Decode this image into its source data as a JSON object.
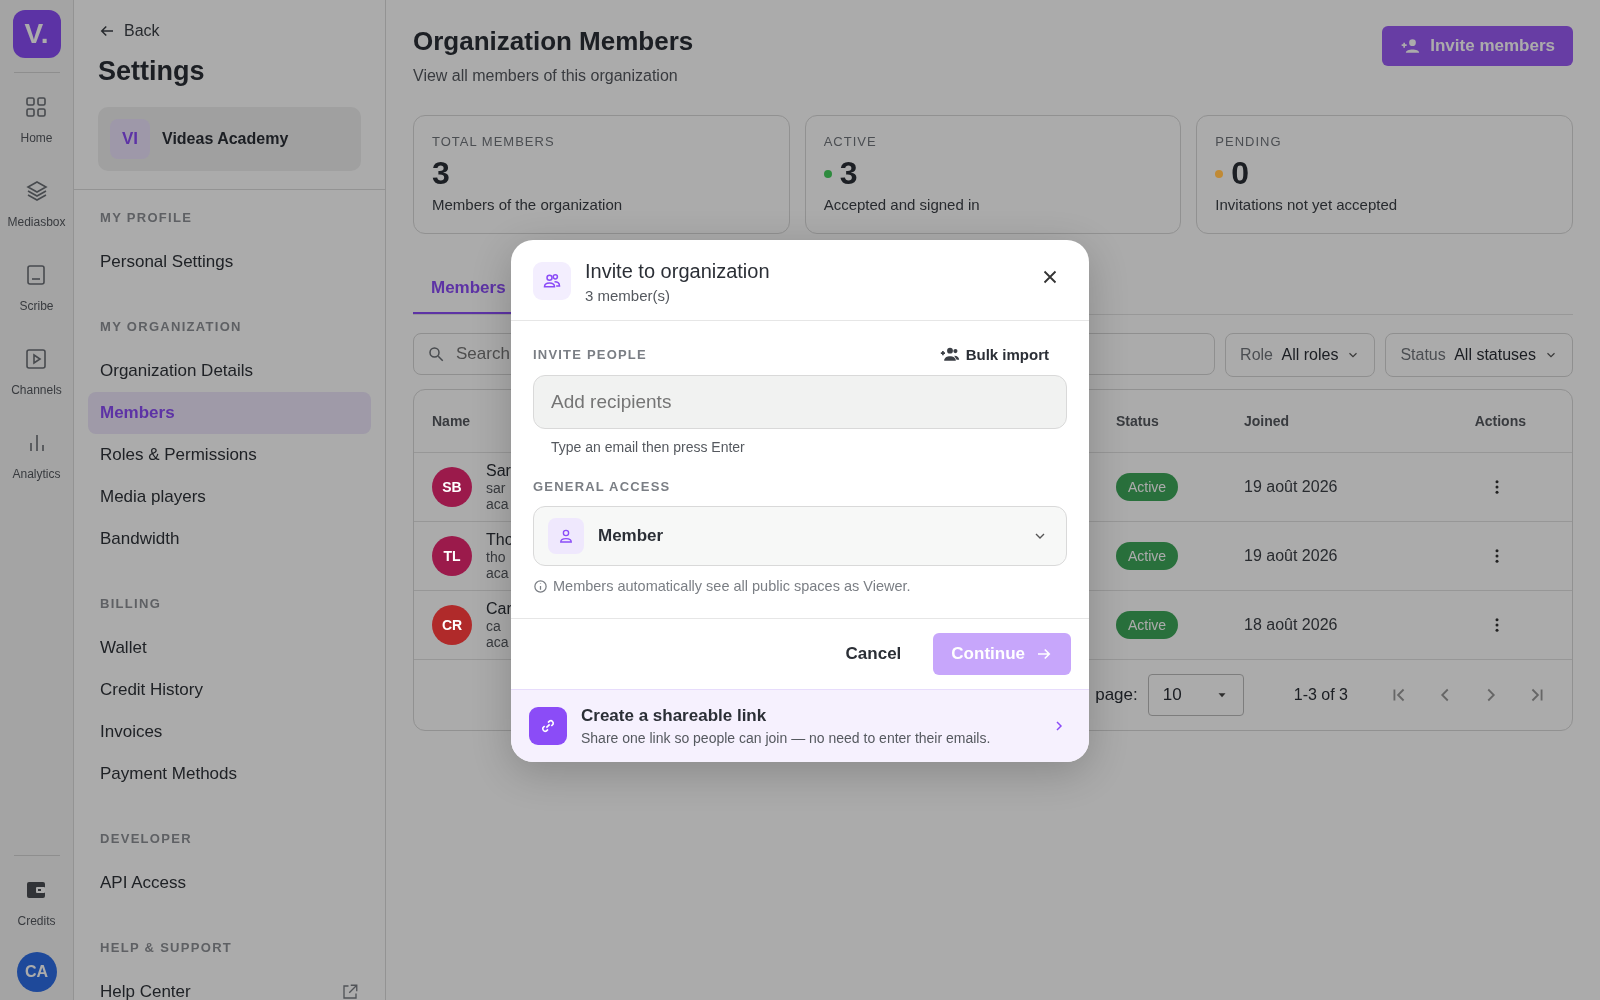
{
  "rail": {
    "logo": "V.",
    "items": [
      {
        "label": "Home"
      },
      {
        "label": "Mediasbox"
      },
      {
        "label": "Scribe"
      },
      {
        "label": "Channels"
      },
      {
        "label": "Analytics"
      }
    ],
    "bottom_item": {
      "label": "Credits"
    },
    "avatar": "CA"
  },
  "settings": {
    "back": "Back",
    "title": "Settings",
    "org": {
      "initials": "VI",
      "name": "Videas Academy"
    },
    "sections": [
      {
        "heading": "MY PROFILE",
        "items": [
          {
            "label": "Personal Settings",
            "selected": false,
            "external": false
          }
        ]
      },
      {
        "heading": "MY ORGANIZATION",
        "items": [
          {
            "label": "Organization Details",
            "selected": false,
            "external": false
          },
          {
            "label": "Members",
            "selected": true,
            "external": false
          },
          {
            "label": "Roles & Permissions",
            "selected": false,
            "external": false
          },
          {
            "label": "Media players",
            "selected": false,
            "external": false
          },
          {
            "label": "Bandwidth",
            "selected": false,
            "external": false
          }
        ]
      },
      {
        "heading": "BILLING",
        "items": [
          {
            "label": "Wallet",
            "selected": false,
            "external": false
          },
          {
            "label": "Credit History",
            "selected": false,
            "external": false
          },
          {
            "label": "Invoices",
            "selected": false,
            "external": false
          },
          {
            "label": "Payment Methods",
            "selected": false,
            "external": false
          }
        ]
      },
      {
        "heading": "DEVELOPER",
        "items": [
          {
            "label": "API Access",
            "selected": false,
            "external": false
          }
        ]
      },
      {
        "heading": "HELP & SUPPORT",
        "items": [
          {
            "label": "Help Center",
            "selected": false,
            "external": true
          }
        ]
      }
    ]
  },
  "main": {
    "title": "Organization Members",
    "subtitle": "View all members of this organization",
    "invite_button": "Invite members",
    "stats": [
      {
        "label": "TOTAL MEMBERS",
        "value": "3",
        "caption": "Members of the organization"
      },
      {
        "label": "ACTIVE",
        "value": "3",
        "caption": "Accepted and signed in",
        "color": "#2e8b3e"
      },
      {
        "label": "PENDING",
        "value": "0",
        "caption": "Invitations not yet accepted",
        "color": "#c08a35"
      }
    ],
    "tabs": [
      {
        "label": "Members",
        "selected": true
      }
    ],
    "search": {
      "placeholder": "Search"
    },
    "filters": [
      {
        "label": "Role",
        "value": "All roles"
      },
      {
        "label": "Status",
        "value": "All statuses"
      }
    ],
    "table": {
      "columns": [
        "Name",
        "Status",
        "Joined",
        "Actions"
      ],
      "rows": [
        {
          "initials": "SB",
          "color": "#9b1a4b",
          "name": "Sar",
          "line_2": "sar",
          "line_3": "aca",
          "status": "Active",
          "joined": "19 août 2026"
        },
        {
          "initials": "TL",
          "color": "#9b1a4b",
          "name": "Tho",
          "line_2": "tho",
          "line_3": "aca",
          "status": "Active",
          "joined": "19 août 2026"
        },
        {
          "initials": "CR",
          "color": "#b02a2a",
          "name": "Car",
          "line_2": "ca",
          "line_3": "aca",
          "status": "Active",
          "joined": "18 août 2026"
        }
      ]
    },
    "pagination": {
      "rows_label": "page:",
      "rows_value": "10",
      "range": "1-3 of 3"
    }
  },
  "modal": {
    "title": "Invite to organization",
    "subtitle": "3 member(s)",
    "invite_label": "INVITE PEOPLE",
    "bulk_import": "Bulk import",
    "recipients": {
      "placeholder": "Add recipients"
    },
    "hint": "Type an email then press Enter",
    "access_label": "GENERAL ACCESS",
    "access_value": "Member",
    "note": "Members automatically see all public spaces as Viewer.",
    "cancel": "Cancel",
    "continue": {
      "label": "Continue",
      "disabled": true
    },
    "link_title": "Create a shareable link",
    "link_text": "Share one link so people can join — no need to enter their emails."
  }
}
